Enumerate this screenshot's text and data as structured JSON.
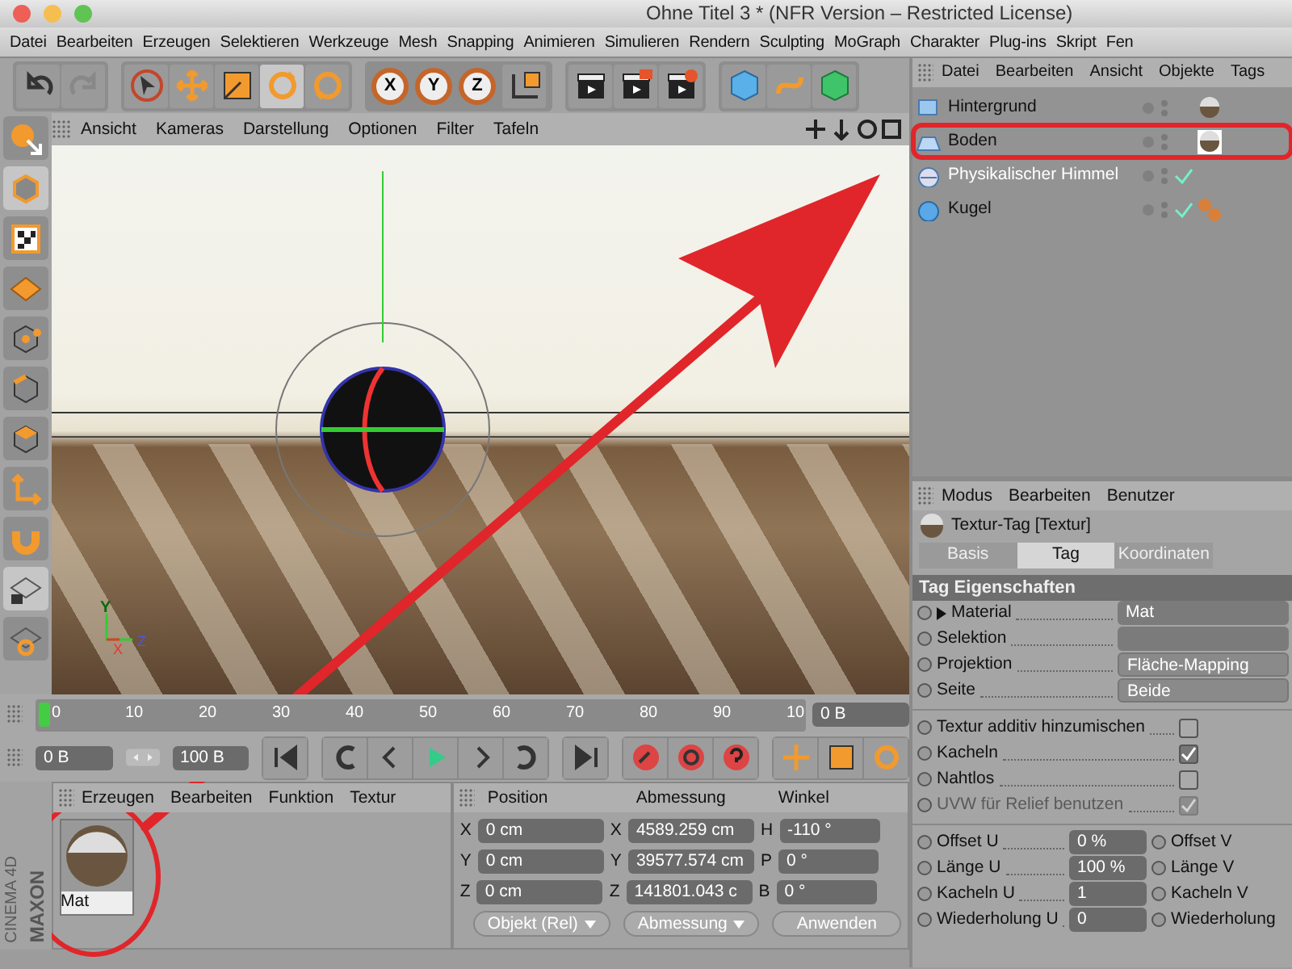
{
  "window": {
    "title": "Ohne Titel 3 * (NFR Version – Restricted License)"
  },
  "menu_bar": [
    "Datei",
    "Bearbeiten",
    "Erzeugen",
    "Selektieren",
    "Werkzeuge",
    "Mesh",
    "Snapping",
    "Animieren",
    "Simulieren",
    "Rendern",
    "Sculpting",
    "MoGraph",
    "Charakter",
    "Plug-ins",
    "Skript",
    "Fen"
  ],
  "toolbar": {
    "axis_keys": [
      "X",
      "Y",
      "Z"
    ]
  },
  "viewport": {
    "menu": [
      "Ansicht",
      "Kameras",
      "Darstellung",
      "Optionen",
      "Filter",
      "Tafeln"
    ],
    "axis_labels": [
      "Y",
      "X",
      "Z"
    ]
  },
  "timeline": {
    "ticks": [
      "0",
      "10",
      "20",
      "30",
      "40",
      "50",
      "60",
      "70",
      "80",
      "90",
      "10"
    ],
    "current_frame": "0 B"
  },
  "transport": {
    "start": "0 B",
    "end": "100 B"
  },
  "materials": {
    "menu": [
      "Erzeugen",
      "Bearbeiten",
      "Funktion",
      "Textur"
    ],
    "items": [
      {
        "name": "Mat"
      }
    ],
    "brand": "MAXON",
    "product": "CINEMA 4D"
  },
  "coordinates": {
    "headers": [
      "Position",
      "Abmessung",
      "Winkel"
    ],
    "rows": [
      {
        "labels": [
          "X",
          "X",
          "H"
        ],
        "values": [
          "0 cm",
          "4589.259 cm",
          "-110 °"
        ]
      },
      {
        "labels": [
          "Y",
          "Y",
          "P"
        ],
        "values": [
          "0 cm",
          "39577.574 cm",
          "0 °"
        ]
      },
      {
        "labels": [
          "Z",
          "Z",
          "B"
        ],
        "values": [
          "0 cm",
          "141801.043 c",
          "0 °"
        ]
      }
    ],
    "dropdowns": [
      "Objekt (Rel)",
      "Abmessung"
    ],
    "apply_button": "Anwenden"
  },
  "objects": {
    "menu": [
      "Datei",
      "Bearbeiten",
      "Ansicht",
      "Objekte",
      "Tags"
    ],
    "items": [
      {
        "name": "Hintergrund",
        "kind": "background",
        "enabled": false,
        "highlighted": false,
        "dimmed": false,
        "tags": [
          {
            "kind": "texture",
            "selected": false
          }
        ]
      },
      {
        "name": "Boden",
        "kind": "floor",
        "enabled": false,
        "highlighted": true,
        "dimmed": false,
        "tags": [
          {
            "kind": "texture",
            "selected": true
          }
        ]
      },
      {
        "name": "Physikalischer Himmel",
        "kind": "sky",
        "enabled": true,
        "highlighted": false,
        "dimmed": true
      },
      {
        "name": "Kugel",
        "kind": "sphere",
        "enabled": true,
        "highlighted": false,
        "dimmed": false,
        "tags": [
          {
            "kind": "phong",
            "selected": false
          }
        ]
      }
    ]
  },
  "attributes": {
    "menu": [
      "Modus",
      "Bearbeiten",
      "Benutzer"
    ],
    "title": "Textur-Tag [Textur]",
    "tabs": [
      {
        "label": "Basis",
        "selected": false
      },
      {
        "label": "Tag",
        "selected": true
      },
      {
        "label": "Koordinaten",
        "selected": false
      }
    ],
    "section": "Tag Eigenschaften",
    "fields": [
      {
        "kind": "link",
        "label": "Material",
        "value": "Mat",
        "expandable": true,
        "animated": false
      },
      {
        "kind": "link",
        "label": "Selektion",
        "expandable": false,
        "animated": false
      },
      {
        "kind": "dropdown",
        "label": "Projektion",
        "value": "Fläche-Mapping",
        "expandable": false,
        "animated": false
      },
      {
        "kind": "dropdown",
        "label": "Seite",
        "value": "Beide",
        "expandable": false,
        "animated": false
      }
    ],
    "options": [
      {
        "label": "Textur additiv hinzumischen",
        "checked": false,
        "disabled": false,
        "animated": false
      },
      {
        "label": "Kacheln",
        "checked": true,
        "disabled": false,
        "animated": false
      },
      {
        "label": "Nahtlos",
        "checked": false,
        "disabled": false,
        "animated": false
      },
      {
        "label": "UVW für Relief benutzen",
        "checked": true,
        "disabled": true,
        "animated": false
      }
    ],
    "numbers": [
      {
        "label": "Offset U",
        "value": "0 %",
        "animated": false,
        "pair_label": "Offset V",
        "pair_animated": false
      },
      {
        "label": "Länge U",
        "value": "100 %",
        "animated": false,
        "pair_label": "Länge V",
        "pair_animated": false
      },
      {
        "label": "Kacheln U",
        "value": "1",
        "animated": false,
        "pair_label": "Kacheln V",
        "pair_animated": false
      },
      {
        "label": "Wiederholung U",
        "value": "0",
        "animated": false,
        "pair_label": "Wiederholung",
        "pair_animated": false
      }
    ]
  }
}
